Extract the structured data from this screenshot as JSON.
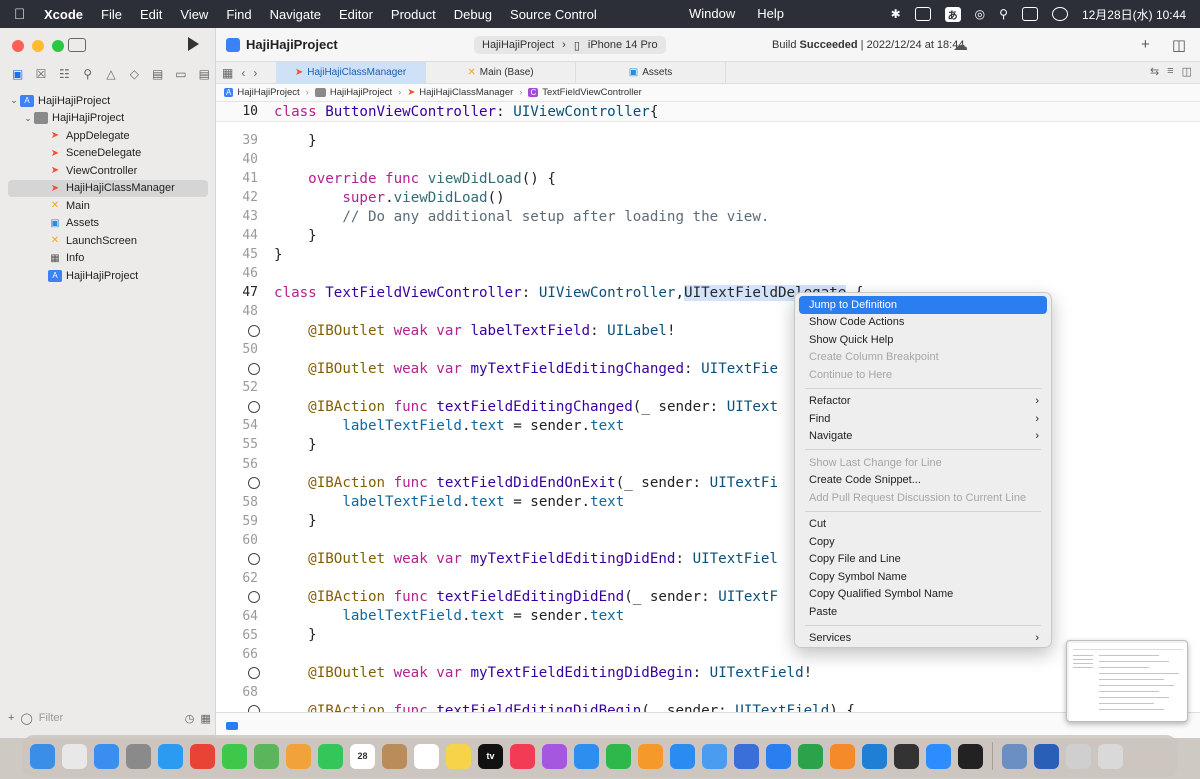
{
  "menubar": {
    "app": "Xcode",
    "items": [
      "File",
      "Edit",
      "View",
      "Find",
      "Navigate",
      "Editor",
      "Product",
      "Debug",
      "Source Control"
    ],
    "center_items": [
      "Window",
      "Help"
    ],
    "ime": "あ",
    "clock": "12月28日(水) 10:44"
  },
  "toolbar": {
    "project_title": "HajiHajiProject",
    "scheme": "HajiHajiProject",
    "device": "iPhone 14 Pro",
    "build_status_prefix": "Build ",
    "build_status_bold": "Succeeded",
    "build_status_suffix": " | 2022/12/24 at 18:44"
  },
  "tabs": [
    {
      "label": "HajiHajiClassManager",
      "icon": "swift-icon",
      "active": true
    },
    {
      "label": "Main (Base)",
      "icon": "xib-icon",
      "active": false
    },
    {
      "label": "Assets",
      "icon": "assets-icon",
      "active": false
    }
  ],
  "jumpbar": [
    "HajiHajiProject",
    "HajiHajiProject",
    "HajiHajiClassManager",
    "TextFieldViewController"
  ],
  "tree": [
    {
      "label": "HajiHajiProject",
      "indent": 0,
      "icon": "project",
      "chev": "v"
    },
    {
      "label": "HajiHajiProject",
      "indent": 1,
      "icon": "folder",
      "chev": "v"
    },
    {
      "label": "AppDelegate",
      "indent": 2,
      "icon": "swift"
    },
    {
      "label": "SceneDelegate",
      "indent": 2,
      "icon": "swift"
    },
    {
      "label": "ViewController",
      "indent": 2,
      "icon": "swift"
    },
    {
      "label": "HajiHajiClassManager",
      "indent": 2,
      "icon": "swift",
      "selected": true
    },
    {
      "label": "Main",
      "indent": 2,
      "icon": "xib"
    },
    {
      "label": "Assets",
      "indent": 2,
      "icon": "assets"
    },
    {
      "label": "LaunchScreen",
      "indent": 2,
      "icon": "xib"
    },
    {
      "label": "Info",
      "indent": 2,
      "icon": "plist"
    },
    {
      "label": "HajiHajiProject",
      "indent": 2,
      "icon": "project"
    }
  ],
  "filter_placeholder": "Filter",
  "sticky_header": {
    "num": "10",
    "tokens": [
      [
        "kw",
        "class "
      ],
      [
        "type",
        "ButtonViewController"
      ],
      [
        "plain",
        ": "
      ],
      [
        "tp",
        "UIViewController"
      ],
      [
        "plain",
        "{"
      ]
    ]
  },
  "code_lines": [
    {
      "num": "39",
      "tokens": [
        [
          "plain",
          "    }"
        ]
      ]
    },
    {
      "num": "40",
      "tokens": []
    },
    {
      "num": "41",
      "tokens": [
        [
          "plain",
          "    "
        ],
        [
          "kw",
          "override func "
        ],
        [
          "fn",
          "viewDidLoad"
        ],
        [
          "plain",
          "() {"
        ]
      ]
    },
    {
      "num": "42",
      "tokens": [
        [
          "plain",
          "        "
        ],
        [
          "kw",
          "super"
        ],
        [
          "plain",
          "."
        ],
        [
          "fn",
          "viewDidLoad"
        ],
        [
          "plain",
          "()"
        ]
      ]
    },
    {
      "num": "43",
      "tokens": [
        [
          "plain",
          "        "
        ],
        [
          "cm",
          "// Do any additional setup after loading the view."
        ]
      ]
    },
    {
      "num": "44",
      "tokens": [
        [
          "plain",
          "    }"
        ]
      ]
    },
    {
      "num": "45",
      "tokens": [
        [
          "plain",
          "}"
        ]
      ]
    },
    {
      "num": "46",
      "tokens": []
    },
    {
      "num": "47",
      "current": true,
      "tokens": [
        [
          "kw",
          "class "
        ],
        [
          "type",
          "TextFieldViewController"
        ],
        [
          "plain",
          ": "
        ],
        [
          "tp",
          "UIViewController"
        ],
        [
          "plain",
          ","
        ],
        [
          "sel",
          "UITextFieldDelegate"
        ],
        [
          "plain",
          " {"
        ]
      ]
    },
    {
      "num": "48",
      "tokens": []
    },
    {
      "num": "",
      "circle": true,
      "tokens": [
        [
          "plain",
          "    "
        ],
        [
          "attr",
          "@IBOutlet "
        ],
        [
          "kw",
          "weak var "
        ],
        [
          "type",
          "labelTextField"
        ],
        [
          "plain",
          ": "
        ],
        [
          "tp",
          "UILabel"
        ],
        [
          "plain",
          "!"
        ]
      ]
    },
    {
      "num": "50",
      "tokens": []
    },
    {
      "num": "",
      "circle": true,
      "tokens": [
        [
          "plain",
          "    "
        ],
        [
          "attr",
          "@IBOutlet "
        ],
        [
          "kw",
          "weak var "
        ],
        [
          "type",
          "myTextFieldEditingChanged"
        ],
        [
          "plain",
          ": "
        ],
        [
          "tp",
          "UITextFie"
        ]
      ]
    },
    {
      "num": "52",
      "tokens": []
    },
    {
      "num": "",
      "circle": true,
      "tokens": [
        [
          "plain",
          "    "
        ],
        [
          "attr",
          "@IBAction "
        ],
        [
          "kw",
          "func "
        ],
        [
          "type",
          "textFieldEditingChanged"
        ],
        [
          "plain",
          "(_ sender: "
        ],
        [
          "tp",
          "UIText"
        ]
      ]
    },
    {
      "num": "54",
      "tokens": [
        [
          "plain",
          "        "
        ],
        [
          "prop",
          "labelTextField"
        ],
        [
          "plain",
          "."
        ],
        [
          "prop",
          "text"
        ],
        [
          "plain",
          " = sender."
        ],
        [
          "prop",
          "text"
        ]
      ]
    },
    {
      "num": "55",
      "tokens": [
        [
          "plain",
          "    }"
        ]
      ]
    },
    {
      "num": "56",
      "tokens": []
    },
    {
      "num": "",
      "circle": true,
      "tokens": [
        [
          "plain",
          "    "
        ],
        [
          "attr",
          "@IBAction "
        ],
        [
          "kw",
          "func "
        ],
        [
          "type",
          "textFieldDidEndOnExit"
        ],
        [
          "plain",
          "(_ sender: "
        ],
        [
          "tp",
          "UITextFi"
        ]
      ]
    },
    {
      "num": "58",
      "tokens": [
        [
          "plain",
          "        "
        ],
        [
          "prop",
          "labelTextField"
        ],
        [
          "plain",
          "."
        ],
        [
          "prop",
          "text"
        ],
        [
          "plain",
          " = sender."
        ],
        [
          "prop",
          "text"
        ]
      ]
    },
    {
      "num": "59",
      "tokens": [
        [
          "plain",
          "    }"
        ]
      ]
    },
    {
      "num": "60",
      "tokens": []
    },
    {
      "num": "",
      "circle": true,
      "tokens": [
        [
          "plain",
          "    "
        ],
        [
          "attr",
          "@IBOutlet "
        ],
        [
          "kw",
          "weak var "
        ],
        [
          "type",
          "myTextFieldEditingDidEnd"
        ],
        [
          "plain",
          ": "
        ],
        [
          "tp",
          "UITextFiel"
        ]
      ]
    },
    {
      "num": "62",
      "tokens": []
    },
    {
      "num": "",
      "circle": true,
      "tokens": [
        [
          "plain",
          "    "
        ],
        [
          "attr",
          "@IBAction "
        ],
        [
          "kw",
          "func "
        ],
        [
          "type",
          "textFieldEditingDidEnd"
        ],
        [
          "plain",
          "(_ sender: "
        ],
        [
          "tp",
          "UITextF"
        ]
      ]
    },
    {
      "num": "64",
      "tokens": [
        [
          "plain",
          "        "
        ],
        [
          "prop",
          "labelTextField"
        ],
        [
          "plain",
          "."
        ],
        [
          "prop",
          "text"
        ],
        [
          "plain",
          " = sender."
        ],
        [
          "prop",
          "text"
        ]
      ]
    },
    {
      "num": "65",
      "tokens": [
        [
          "plain",
          "    }"
        ]
      ]
    },
    {
      "num": "66",
      "tokens": []
    },
    {
      "num": "",
      "circle": true,
      "tokens": [
        [
          "plain",
          "    "
        ],
        [
          "attr",
          "@IBOutlet "
        ],
        [
          "kw",
          "weak var "
        ],
        [
          "type",
          "myTextFieldEditingDidBegin"
        ],
        [
          "plain",
          ": "
        ],
        [
          "tp",
          "UITextField"
        ],
        [
          "plain",
          "!"
        ]
      ]
    },
    {
      "num": "68",
      "tokens": []
    },
    {
      "num": "",
      "circle": true,
      "tokens": [
        [
          "plain",
          "    "
        ],
        [
          "attr",
          "@IBAction "
        ],
        [
          "kw",
          "func "
        ],
        [
          "type",
          "textFieldEditingDidBegin"
        ],
        [
          "plain",
          "(_ sender: "
        ],
        [
          "tp",
          "UITextField"
        ],
        [
          "plain",
          ") {"
        ]
      ]
    }
  ],
  "context_menu": [
    {
      "label": "Jump to Definition",
      "state": "highlighted"
    },
    {
      "label": "Show Code Actions"
    },
    {
      "label": "Show Quick Help"
    },
    {
      "label": "Create Column Breakpoint",
      "state": "disabled"
    },
    {
      "label": "Continue to Here",
      "state": "disabled"
    },
    {
      "sep": true
    },
    {
      "label": "Refactor",
      "submenu": true
    },
    {
      "label": "Find",
      "submenu": true
    },
    {
      "label": "Navigate",
      "submenu": true
    },
    {
      "sep": true
    },
    {
      "label": "Show Last Change for Line",
      "state": "disabled"
    },
    {
      "label": "Create Code Snippet..."
    },
    {
      "label": "Add Pull Request Discussion to Current Line",
      "state": "disabled"
    },
    {
      "sep": true
    },
    {
      "label": "Cut"
    },
    {
      "label": "Copy"
    },
    {
      "label": "Copy File and Line"
    },
    {
      "label": "Copy Symbol Name"
    },
    {
      "label": "Copy Qualified Symbol Name"
    },
    {
      "label": "Paste"
    },
    {
      "sep": true
    },
    {
      "label": "Services",
      "submenu": true
    }
  ],
  "dock": [
    {
      "name": "finder",
      "color": "#3a8ee6"
    },
    {
      "name": "launchpad",
      "color": "#e8e8e8"
    },
    {
      "name": "mail",
      "color": "#3a8ef0"
    },
    {
      "name": "system-settings",
      "color": "#8a8a8a"
    },
    {
      "name": "safari",
      "color": "#2a9bf0"
    },
    {
      "name": "chrome",
      "color": "#e84335"
    },
    {
      "name": "messages",
      "color": "#3ec84a"
    },
    {
      "name": "maps",
      "color": "#5bb55a"
    },
    {
      "name": "photos",
      "color": "#f2a23a"
    },
    {
      "name": "facetime",
      "color": "#35c659"
    },
    {
      "name": "calendar",
      "color": "#ffffff",
      "text": "28"
    },
    {
      "name": "contacts",
      "color": "#b98c5a"
    },
    {
      "name": "reminders",
      "color": "#ffffff"
    },
    {
      "name": "notes",
      "color": "#f7d34a"
    },
    {
      "name": "tv",
      "color": "#111111",
      "text": "tv"
    },
    {
      "name": "music",
      "color": "#f33b55"
    },
    {
      "name": "podcasts",
      "color": "#a557e0"
    },
    {
      "name": "keynote",
      "color": "#2d8ef0"
    },
    {
      "name": "numbers",
      "color": "#2fb84a"
    },
    {
      "name": "pages",
      "color": "#f59a2a"
    },
    {
      "name": "app-store",
      "color": "#2a8cf0"
    },
    {
      "name": "preview",
      "color": "#4a9cf0"
    },
    {
      "name": "xcode-instruments",
      "color": "#3a6ed8"
    },
    {
      "name": "xcode",
      "color": "#2a7ef0"
    },
    {
      "name": "dev-tool",
      "color": "#2ca24a"
    },
    {
      "name": "books",
      "color": "#f58a2a"
    },
    {
      "name": "vscode",
      "color": "#1f7fd4"
    },
    {
      "name": "github",
      "color": "#333333"
    },
    {
      "name": "zoom",
      "color": "#2d8cff"
    },
    {
      "name": "terminal",
      "color": "#222222"
    },
    {
      "name": "sep"
    },
    {
      "name": "screenshot",
      "color": "#6a8fc0"
    },
    {
      "name": "downloads",
      "color": "#2a5fb8"
    },
    {
      "name": "font-book",
      "color": "#cfcfcf"
    },
    {
      "name": "trash",
      "color": "#d9d9d9"
    }
  ]
}
